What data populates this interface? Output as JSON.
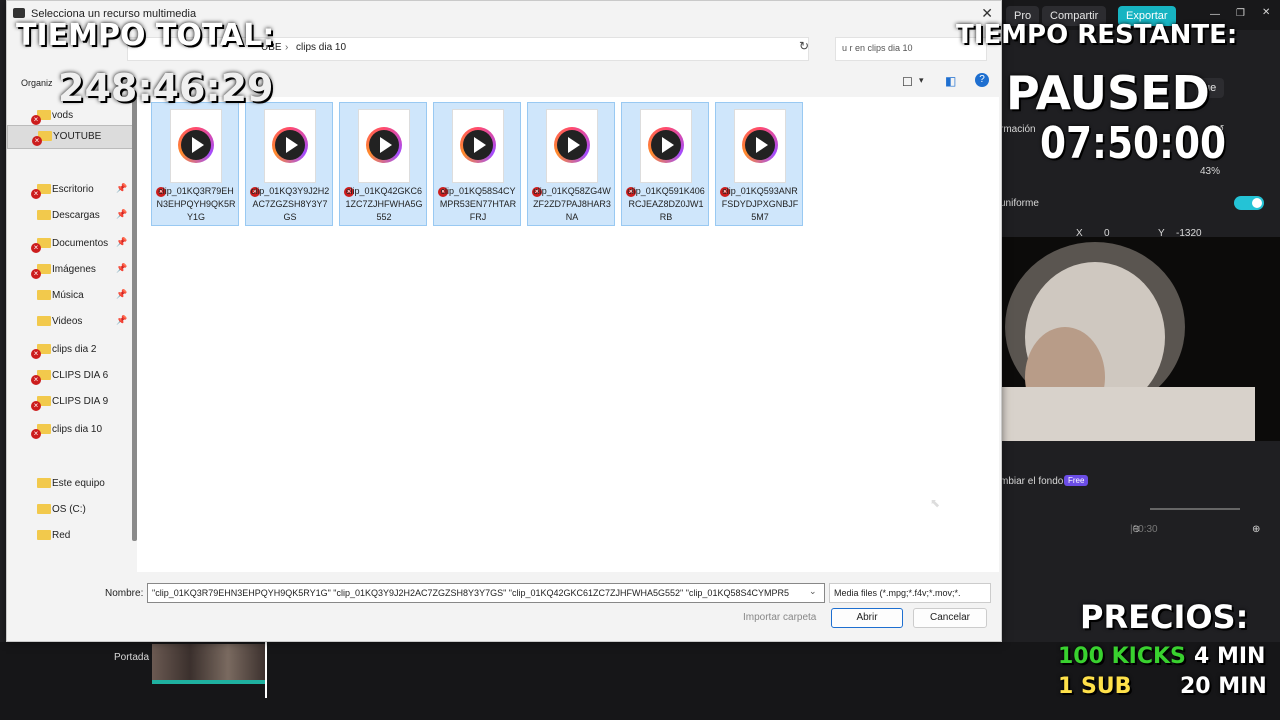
{
  "dialog": {
    "title": "Selecciona un recurso multimedia",
    "breadcrumb": [
      "UBE",
      "clips dia 10"
    ],
    "search_placeholder": "u r en clips dia 10",
    "organize": "Organiz",
    "nav": [
      {
        "label": "vods",
        "selected": false,
        "badge": true,
        "pin": false
      },
      {
        "label": "YOUTUBE",
        "selected": true,
        "badge": true,
        "pin": false
      },
      {
        "label": "Escritorio",
        "selected": false,
        "badge": true,
        "pin": true
      },
      {
        "label": "Descargas",
        "selected": false,
        "badge": false,
        "pin": true
      },
      {
        "label": "Documentos",
        "selected": false,
        "badge": true,
        "pin": true
      },
      {
        "label": "Imágenes",
        "selected": false,
        "badge": true,
        "pin": true
      },
      {
        "label": "Música",
        "selected": false,
        "badge": false,
        "pin": true
      },
      {
        "label": "Videos",
        "selected": false,
        "badge": false,
        "pin": true
      },
      {
        "label": "clips dia 2",
        "selected": false,
        "badge": true,
        "pin": false
      },
      {
        "label": "CLIPS DIA 6",
        "selected": false,
        "badge": true,
        "pin": false
      },
      {
        "label": "CLIPS DIA 9",
        "selected": false,
        "badge": true,
        "pin": false
      },
      {
        "label": "clips dia 10",
        "selected": false,
        "badge": true,
        "pin": false
      },
      {
        "label": "Este equipo",
        "selected": false,
        "badge": false,
        "pin": false
      },
      {
        "label": "OS (C:)",
        "selected": false,
        "badge": false,
        "pin": false
      },
      {
        "label": "Red",
        "selected": false,
        "badge": false,
        "pin": false
      }
    ],
    "files": [
      "clip_01KQ3R79EHN3EHPQYH9QK5RY1G",
      "clip_01KQ3Y9J2H2AC7ZGZSH8Y3Y7GS",
      "clip_01KQ42GKC61ZC7ZJHFWHA5G552",
      "clip_01KQ58S4CYMPR53EN77HTARFRJ",
      "clip_01KQ58ZG4WZF2ZD7PAJ8HAR3NA",
      "clip_01KQ591K406RCJEAZ8DZ0JW1RB",
      "clip_01KQ593ANRFSDYDJPXGNBJF5M7"
    ],
    "name_label": "Nombre:",
    "name_value": "\"clip_01KQ3R79EHN3EHPQYH9QK5RY1G\" \"clip_01KQ3Y9J2H2AC7ZGZSH8Y3Y7GS\" \"clip_01KQ42GKC61ZC7ZJHFWHA5G552\" \"clip_01KQ58S4CYMPR5",
    "filter": "Media files (*.mpg;*.f4v;*.mov;*.",
    "import_folder": "Importar carpeta",
    "open": "Abrir",
    "cancel": "Cancelar"
  },
  "editor": {
    "pro": "Pro",
    "share": "Compartir",
    "export": "Exportar",
    "right_btn": "ue",
    "macion": "rmación",
    "zoom": "43%",
    "uniform": "uniforme",
    "x_label": "X",
    "x_value": "0",
    "y_label": "Y",
    "y_value": "-1320",
    "bg_label": "mbiar el fondo",
    "free": "Free",
    "timecode": "|00:30",
    "portada": "Portada"
  },
  "overlay": {
    "tiempo_total_label": "TIEMPO TOTAL:",
    "tiempo_total_value": "248:46:29",
    "tiempo_restante_label": "TIEMPO RESTANTE:",
    "paused": "PAUSED",
    "restante_value": "07:50:00",
    "precios_label": "PRECIOS:",
    "price_1_item": "100 KICKS",
    "price_1_value": "4 MIN",
    "price_2_item": "1 SUB",
    "price_2_value": "20 MIN",
    "accent_green": "#39d12f",
    "accent_yellow": "#ffe14a"
  }
}
